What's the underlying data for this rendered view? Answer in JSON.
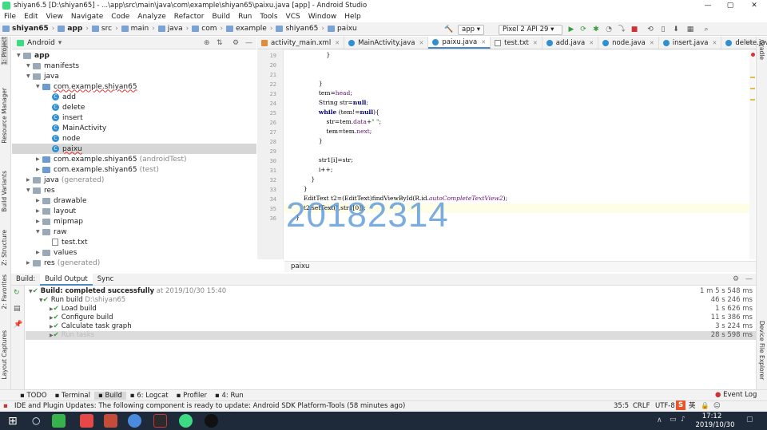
{
  "window": {
    "title": "shiyan6.5 [D:\\shiyan65] - ...\\app\\src\\main\\java\\com\\example\\shiyan65\\paixu.java [app] - Android Studio",
    "min": "—",
    "max": "▢",
    "close": "✕"
  },
  "menu": [
    "File",
    "Edit",
    "View",
    "Navigate",
    "Code",
    "Analyze",
    "Refactor",
    "Build",
    "Run",
    "Tools",
    "VCS",
    "Window",
    "Help"
  ],
  "breadcrumb": [
    "shiyan65",
    "app",
    "src",
    "main",
    "java",
    "com",
    "example",
    "shiyan65",
    "paixu"
  ],
  "toolbar": {
    "config": "app",
    "device": "Pixel 2 API 29"
  },
  "project": {
    "view": "Android",
    "tree": [
      {
        "t": "app",
        "lvl": 0,
        "kind": "folder",
        "bold": true
      },
      {
        "t": "manifests",
        "lvl": 1,
        "kind": "folder"
      },
      {
        "t": "java",
        "lvl": 1,
        "kind": "folder"
      },
      {
        "t": "com.example.shiyan65",
        "lvl": 2,
        "kind": "pkg",
        "squig": true
      },
      {
        "t": "add",
        "lvl": 3,
        "kind": "class"
      },
      {
        "t": "delete",
        "lvl": 3,
        "kind": "class"
      },
      {
        "t": "insert",
        "lvl": 3,
        "kind": "class"
      },
      {
        "t": "MainActivity",
        "lvl": 3,
        "kind": "class"
      },
      {
        "t": "node",
        "lvl": 3,
        "kind": "class"
      },
      {
        "t": "paixu",
        "lvl": 3,
        "kind": "class",
        "sel": true,
        "squig": true
      },
      {
        "t": "com.example.shiyan65",
        "lvl": 2,
        "kind": "pkg",
        "suffix": "(androidTest)"
      },
      {
        "t": "com.example.shiyan65",
        "lvl": 2,
        "kind": "pkg",
        "suffix": "(test)"
      },
      {
        "t": "java",
        "lvl": 1,
        "kind": "folder",
        "suffix": "(generated)"
      },
      {
        "t": "res",
        "lvl": 1,
        "kind": "folder"
      },
      {
        "t": "drawable",
        "lvl": 2,
        "kind": "folder"
      },
      {
        "t": "layout",
        "lvl": 2,
        "kind": "folder"
      },
      {
        "t": "mipmap",
        "lvl": 2,
        "kind": "folder"
      },
      {
        "t": "raw",
        "lvl": 2,
        "kind": "folder"
      },
      {
        "t": "test.txt",
        "lvl": 3,
        "kind": "file"
      },
      {
        "t": "values",
        "lvl": 2,
        "kind": "folder"
      },
      {
        "t": "res",
        "lvl": 1,
        "kind": "folder",
        "suffix": "(generated)"
      }
    ]
  },
  "tabs": [
    {
      "label": "activity_main.xml",
      "type": "xml"
    },
    {
      "label": "MainActivity.java",
      "type": "java"
    },
    {
      "label": "paixu.java",
      "type": "java",
      "active": true
    },
    {
      "label": "test.txt",
      "type": "txt"
    },
    {
      "label": "add.java",
      "type": "java"
    },
    {
      "label": "node.java",
      "type": "java"
    },
    {
      "label": "insert.java",
      "type": "java"
    },
    {
      "label": "delete.java",
      "type": "java"
    }
  ],
  "editor": {
    "lines": [
      "19",
      "20",
      "21",
      "22",
      "23",
      "24",
      "25",
      "26",
      "27",
      "28",
      "29",
      "30",
      "31",
      "32",
      "33",
      "34",
      "35",
      "36"
    ],
    "code_crumb": "paixu",
    "watermark": "20182314"
  },
  "build": {
    "tabs": [
      "Build:",
      "Build Output",
      "Sync"
    ],
    "rows": [
      {
        "lvl": 0,
        "text": "Build: completed successfully",
        "extra": "at 2019/10/30 15:40",
        "time": "1 m 5 s 548 ms",
        "bold": true
      },
      {
        "lvl": 1,
        "text": "Run build",
        "extra": "D:\\shiyan65",
        "time": "46 s 246 ms"
      },
      {
        "lvl": 2,
        "text": "Load build",
        "time": "1 s 626 ms"
      },
      {
        "lvl": 2,
        "text": "Configure build",
        "time": "11 s 386 ms"
      },
      {
        "lvl": 2,
        "text": "Calculate task graph",
        "time": "3 s 224 ms"
      },
      {
        "lvl": 2,
        "text": "Run tasks",
        "time": "28 s 598 ms",
        "sel": true
      }
    ]
  },
  "toolwindows": [
    "TODO",
    "Terminal",
    "Build",
    "6: Logcat",
    "Profiler",
    "4: Run"
  ],
  "eventlog": "Event Log",
  "status": {
    "message": "IDE and Plugin Updates: The following component is ready to update: Android SDK Platform-Tools (58 minutes ago)",
    "pos": "35:5",
    "crlf": "CRLF",
    "enc": "UTF-8"
  },
  "leftstrip": [
    "1: Project",
    "Resource Manager",
    "Build Variants",
    "Z: Structure",
    "2: Favorites",
    "Layout Captures"
  ],
  "rightstrip": [
    "Gradle",
    "Device File Explorer"
  ],
  "clock": {
    "time": "17:12",
    "date": "2019/10/30",
    "ime": "英"
  },
  "colors": {
    "accent": "#4a88c7",
    "watermark": "#468cd7",
    "taskbar": "#1e2a3a"
  }
}
